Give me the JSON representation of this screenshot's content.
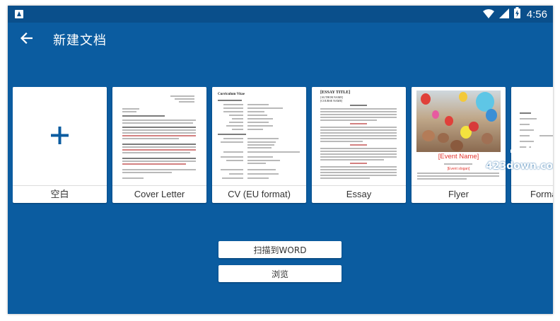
{
  "status_bar": {
    "time": "4:56",
    "icons": [
      "app-notification-icon",
      "wifi-icon",
      "signal-icon",
      "battery-charging-icon"
    ]
  },
  "app_bar": {
    "title": "新建文档",
    "back_icon": "arrow-left-icon"
  },
  "templates": [
    {
      "label": "空白",
      "icon": "plus-icon"
    },
    {
      "label": "Cover Letter"
    },
    {
      "label": "CV (EU format)"
    },
    {
      "label": "Essay"
    },
    {
      "label": "Flyer",
      "event_name": "[Event Name]",
      "sub_heading": "[Event slogan]"
    },
    {
      "label": "Forma"
    }
  ],
  "thumb_text": {
    "cv_title": "Curriculum Vitae",
    "essay_title": "[ESSAY TITLE]",
    "essay_author": "[AUTHOR NAME]",
    "essay_course": "[COURSE NAME]"
  },
  "actions": {
    "scan_label": "扫描到WORD",
    "browse_label": "浏览"
  },
  "watermark": {
    "logo_text": "423",
    "text": "423down.com"
  },
  "colors": {
    "background": "#0b5ca0",
    "status_bar": "#0a4f8b",
    "accent": "#0b5ca0",
    "flyer_red": "#e2332b"
  }
}
